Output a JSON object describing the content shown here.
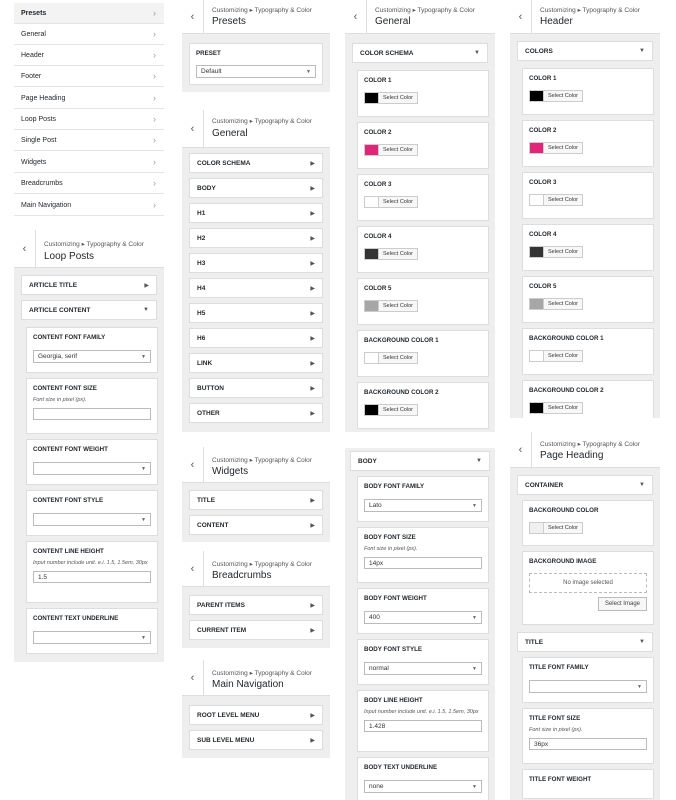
{
  "menu": [
    "Presets",
    "General",
    "Header",
    "Footer",
    "Page Heading",
    "Loop Posts",
    "Single Post",
    "Widgets",
    "Breadcrumbs",
    "Main Navigation"
  ],
  "crumb": "Customizing ▸ Typography & Color",
  "presets": {
    "title": "Presets",
    "section": "PRESET",
    "value": "Default"
  },
  "general_list": {
    "title": "General",
    "items": [
      "COLOR SCHEMA",
      "BODY",
      "H1",
      "H2",
      "H3",
      "H4",
      "H5",
      "H6",
      "LINK",
      "BUTTON",
      "OTHER"
    ]
  },
  "color_schema": {
    "title": "General",
    "section": "COLOR SCHEMA",
    "button": "Select Color",
    "colors": [
      {
        "label": "COLOR 1",
        "color": "#000000"
      },
      {
        "label": "COLOR 2",
        "color": "#e0267a"
      },
      {
        "label": "COLOR 3",
        "color": "#ffffff"
      },
      {
        "label": "COLOR 4",
        "color": "#333333"
      },
      {
        "label": "COLOR 5",
        "color": "#a6a6a6"
      },
      {
        "label": "BACKGROUND COLOR 1",
        "color": "#ffffff"
      },
      {
        "label": "BACKGROUND COLOR 2",
        "color": "#000000"
      }
    ]
  },
  "header_colors": {
    "title": "Header",
    "section": "COLORS",
    "button": "Select Color",
    "colors": [
      {
        "label": "COLOR 1",
        "color": "#000000"
      },
      {
        "label": "COLOR 2",
        "color": "#e0267a"
      },
      {
        "label": "COLOR 3",
        "color": "#ffffff"
      },
      {
        "label": "COLOR 4",
        "color": "#333333"
      },
      {
        "label": "COLOR 5",
        "color": "#a6a6a6"
      },
      {
        "label": "BACKGROUND COLOR 1",
        "color": "#ffffff"
      },
      {
        "label": "BACKGROUND COLOR 2",
        "color": "#000000"
      }
    ]
  },
  "loop_posts": {
    "title": "Loop Posts",
    "section1": "ARTICLE TITLE",
    "section2": "ARTICLE CONTENT",
    "family_label": "CONTENT FONT FAMILY",
    "family_value": "Georgia, serif",
    "size_label": "CONTENT FONT SIZE",
    "size_desc": "Font size in pixel (px).",
    "weight_label": "CONTENT FONT WEIGHT",
    "style_label": "CONTENT FONT STYLE",
    "lh_label": "CONTENT LINE HEIGHT",
    "lh_desc": "Input number include unit. e.i. 1.5, 1.5em, 30px",
    "lh_value": "1.5",
    "underline_label": "CONTENT TEXT UNDERLINE"
  },
  "widgets": {
    "title": "Widgets",
    "items": [
      "TITLE",
      "CONTENT"
    ]
  },
  "breadcrumbs": {
    "title": "Breadcrumbs",
    "items": [
      "PARENT ITEMS",
      "CURRENT ITEM"
    ]
  },
  "main_nav": {
    "title": "Main Navigation",
    "items": [
      "ROOT LEVEL MENU",
      "SUB LEVEL MENU"
    ]
  },
  "body": {
    "section": "BODY",
    "family_label": "BODY FONT FAMILY",
    "family_value": "Lato",
    "size_label": "BODY FONT SIZE",
    "size_desc": "Font size in pixel (px).",
    "size_value": "14px",
    "weight_label": "BODY FONT WEIGHT",
    "weight_value": "400",
    "style_label": "BODY FONT STYLE",
    "style_value": "normal",
    "lh_label": "BODY LINE HEIGHT",
    "lh_desc": "Input number include unit. e.i. 1.5, 1.5em, 30px",
    "lh_value": "1.428",
    "underline_label": "BODY TEXT UNDERLINE",
    "underline_value": "none"
  },
  "page_heading": {
    "title": "Page Heading",
    "section": "CONTAINER",
    "bg_color_label": "BACKGROUND COLOR",
    "bg_color_button": "Select Color",
    "bg_color": "#f0f0f0",
    "bg_image_label": "BACKGROUND IMAGE",
    "no_image": "No image selected",
    "select_image": "Select Image",
    "section2": "TITLE",
    "tf_family_label": "TITLE FONT FAMILY",
    "tf_size_label": "TITLE FONT SIZE",
    "tf_size_desc": "Font size in pixel (px).",
    "tf_size_value": "36px",
    "tf_weight_label": "TITLE FONT WEIGHT"
  }
}
